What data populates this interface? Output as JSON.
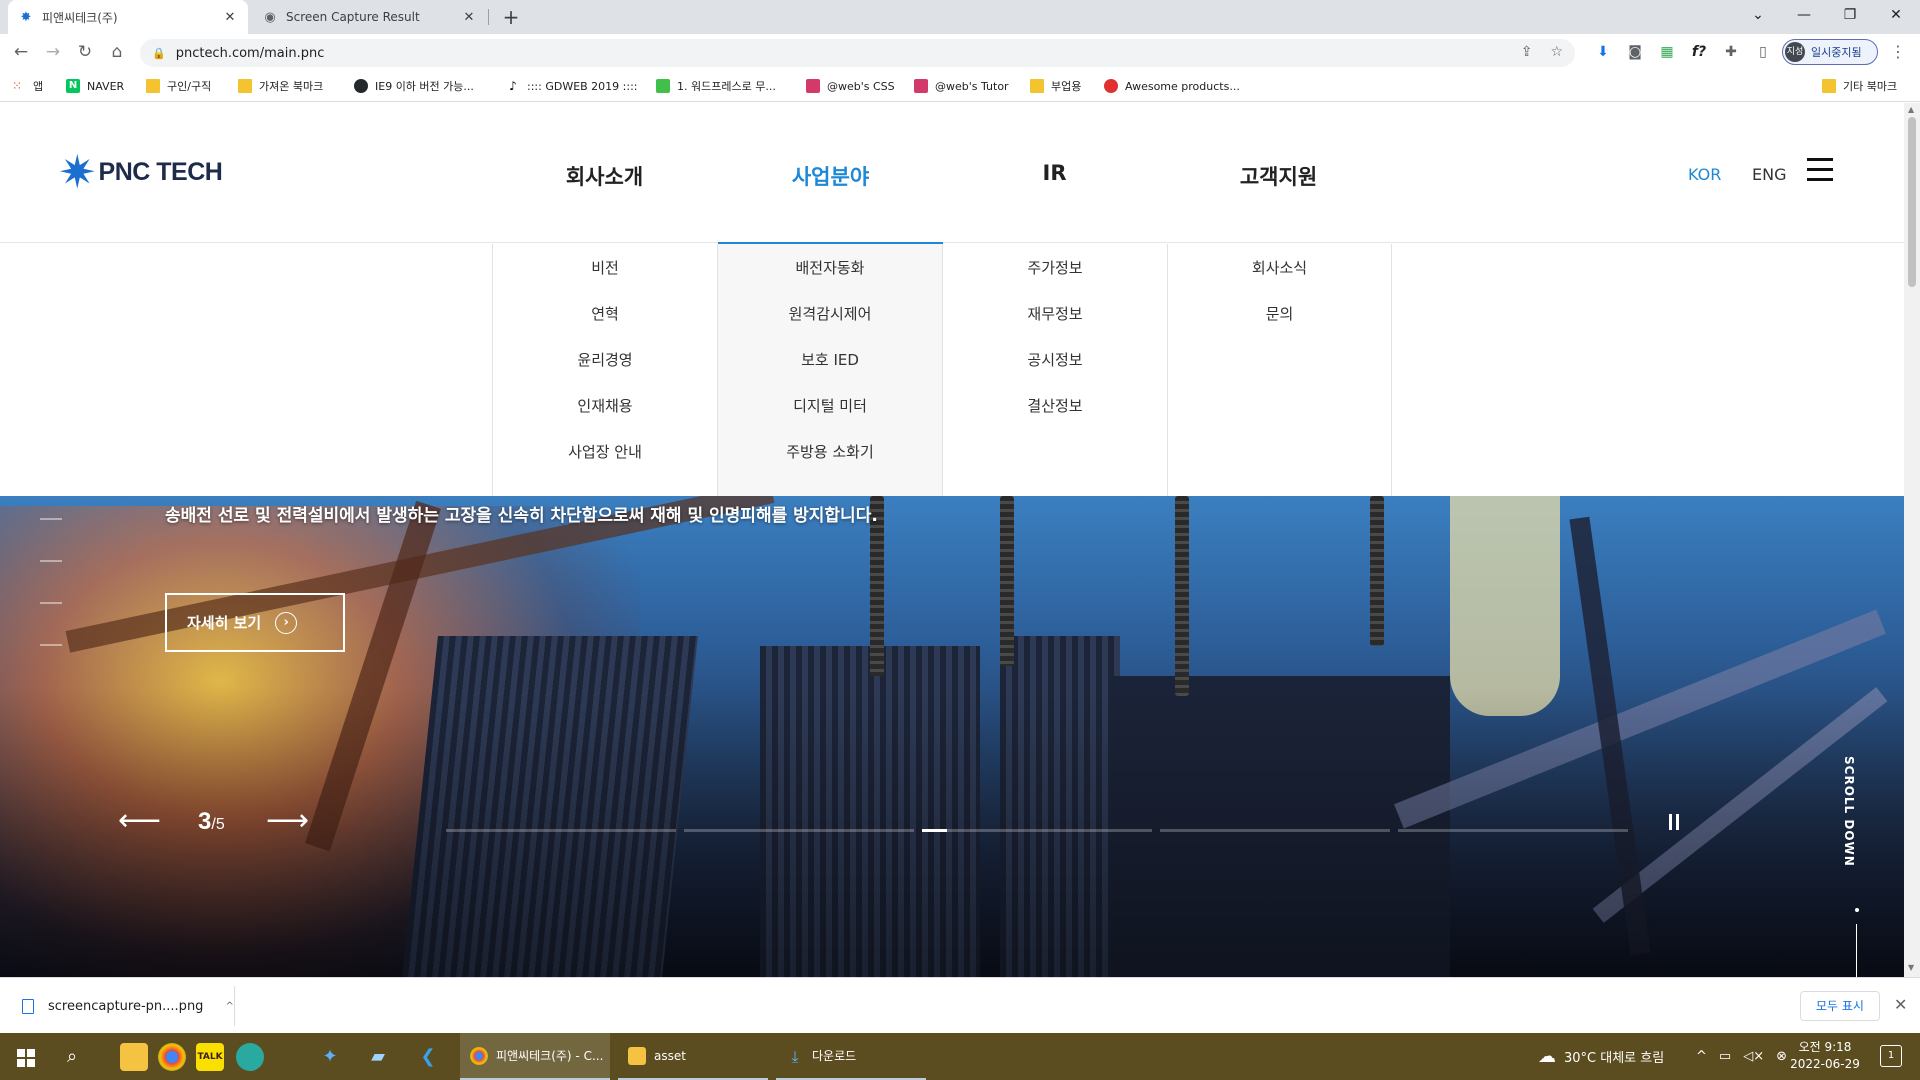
{
  "browser": {
    "tabs": [
      {
        "title": "피앤씨테크(주)",
        "active": true
      },
      {
        "title": "Screen Capture Result",
        "active": false
      }
    ],
    "url": "pnctech.com/main.pnc",
    "profile_initials": "지성",
    "profile_label": "일시중지됨",
    "bookmarks": [
      {
        "label": "앱",
        "icon": "apps-grid-icon"
      },
      {
        "label": "NAVER",
        "icon": "naver-icon"
      },
      {
        "label": "구인/구직",
        "icon": "folder-icon"
      },
      {
        "label": "가져온 북마크",
        "icon": "folder-icon"
      },
      {
        "label": "IE9 이하 버전 가능...",
        "icon": "github-icon"
      },
      {
        "label": ":::: GDWEB 2019 ::::",
        "icon": "tiktok-icon"
      },
      {
        "label": "1. 워드프레스로 무...",
        "icon": "green-site-icon"
      },
      {
        "label": "@web's CSS",
        "icon": "pink-site-icon"
      },
      {
        "label": "@web's Tutor",
        "icon": "pink-site-icon"
      },
      {
        "label": "부업용",
        "icon": "folder-icon"
      },
      {
        "label": "Awesome products...",
        "icon": "red-site-icon"
      }
    ],
    "other_bookmarks": "기타 북마크"
  },
  "site": {
    "logo_text": "PNC TECH",
    "gnb": [
      "회사소개",
      "사업분야",
      "IR",
      "고객지원"
    ],
    "gnb_active_index": 1,
    "lang": [
      "KOR",
      "ENG"
    ],
    "mega_menu": [
      [
        "비전",
        "연혁",
        "윤리경영",
        "인재채용",
        "사업장 안내"
      ],
      [
        "배전자동화",
        "원격감시제어",
        "보호 IED",
        "디지털 미터",
        "주방용 소화기"
      ],
      [
        "주가정보",
        "재무정보",
        "공시정보",
        "결산정보"
      ],
      [
        "회사소식",
        "문의"
      ]
    ],
    "hero": {
      "description": "송배전 선로 및 전력설비에서 발생하는 고장을 신속히 차단함으로써 재해 및 인명피해를 방지합니다.",
      "button_label": "자세히 보기",
      "current_slide": "3",
      "separator": "/",
      "total_slides": "5",
      "slide_progress": [
        0,
        0,
        0.11,
        0,
        0
      ],
      "scroll_down": "SCROLL DOWN"
    }
  },
  "download_bar": {
    "file": "screencapture-pn....png",
    "show_all": "모두 표시"
  },
  "taskbar": {
    "tasks": [
      {
        "label": "피앤씨테크(주) - C...",
        "icon": "chrome-icon",
        "active": true
      },
      {
        "label": "asset",
        "icon": "folder-icon",
        "active": false
      },
      {
        "label": "다운로드",
        "icon": "download-icon",
        "active": false
      }
    ],
    "weather": "30°C  대체로 흐림",
    "time": "오전 9:18",
    "date": "2022-06-29",
    "notification_count": "1"
  }
}
